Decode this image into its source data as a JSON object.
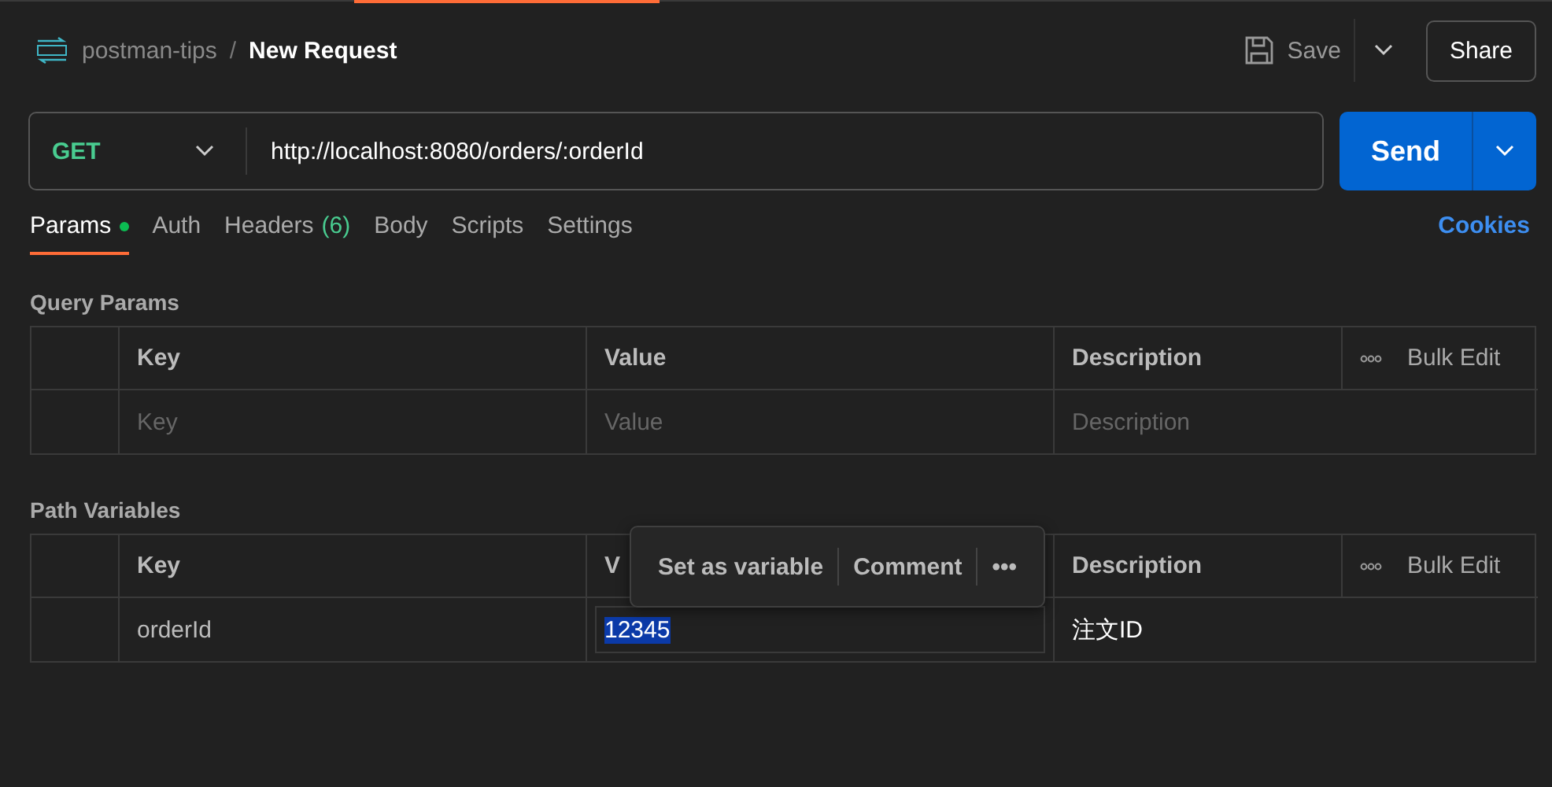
{
  "breadcrumb": {
    "collection": "postman-tips",
    "separator": "/",
    "request": "New Request"
  },
  "toolbar": {
    "save": "Save",
    "share": "Share"
  },
  "request": {
    "method": "GET",
    "url": "http://localhost:8080/orders/:orderId",
    "send": "Send"
  },
  "tabs": [
    {
      "label": "Params",
      "dot": true,
      "selected": true
    },
    {
      "label": "Auth",
      "dot": false,
      "selected": false
    },
    {
      "label": "Headers",
      "count": "(6)",
      "dot": false,
      "selected": false
    },
    {
      "label": "Body",
      "dot": false,
      "selected": false
    },
    {
      "label": "Scripts",
      "dot": false,
      "selected": false
    },
    {
      "label": "Settings",
      "dot": false,
      "selected": false
    }
  ],
  "cookies": "Cookies",
  "sections": [
    {
      "title": "Query Params",
      "columns": [
        "Key",
        "Value",
        "Description"
      ],
      "bulk_edit": "Bulk Edit",
      "rows": [
        {
          "key": "Key",
          "value": "Value",
          "description": "Description",
          "kind": "placeholder"
        }
      ]
    },
    {
      "title": "Path Variables",
      "columns": [
        "Key",
        "V",
        "Description"
      ],
      "bulk_edit": "Bulk Edit",
      "rows": [
        {
          "key": "orderId",
          "value": "12345",
          "description": "注文ID",
          "kind": "filled",
          "value_selected": true
        }
      ],
      "popup": {
        "items": [
          "Set as variable",
          "Comment"
        ],
        "more": "•••"
      }
    }
  ]
}
